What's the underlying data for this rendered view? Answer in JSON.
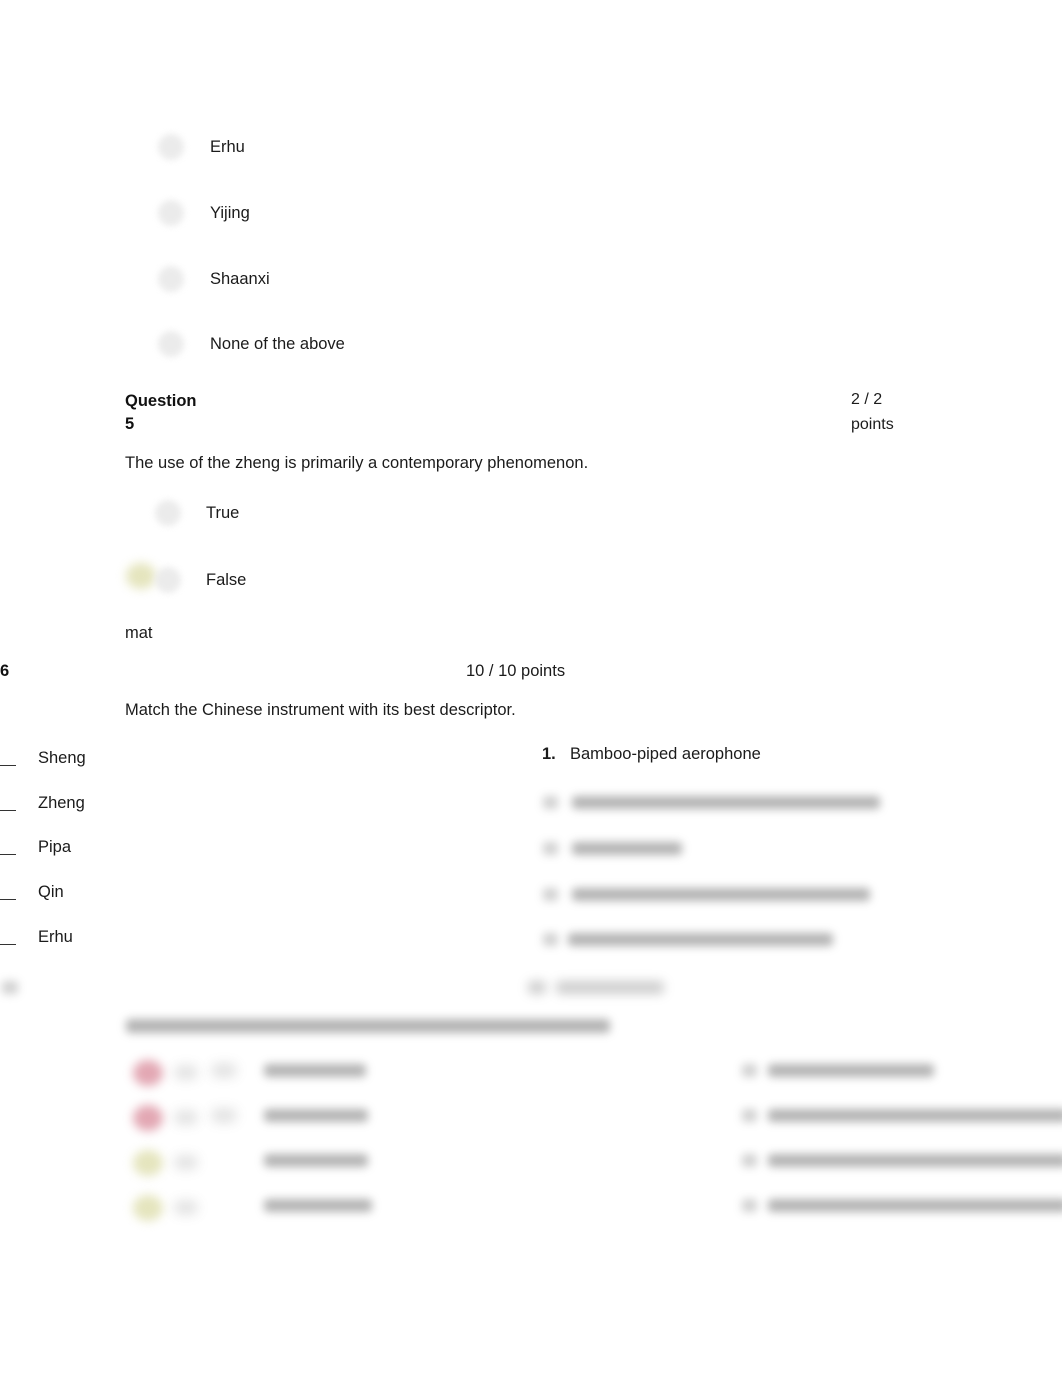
{
  "document": {
    "type": "quiz-results",
    "background_color": "#ffffff"
  },
  "question_4_options": {
    "items": [
      {
        "label": "Erhu"
      },
      {
        "label": "Yijing"
      },
      {
        "label": "Shaanxi"
      },
      {
        "label": "None of the above"
      }
    ]
  },
  "question_5": {
    "header_line_1": "Question",
    "header_line_2": "5",
    "points_line_1": "2 / 2",
    "points_line_2": "points",
    "prompt": "The use of the zheng is primarily a contemporary phenomenon.",
    "options": [
      {
        "label": "True",
        "marked": false
      },
      {
        "label": "False",
        "marked": true
      }
    ]
  },
  "fragment": {
    "text": "mat"
  },
  "question_6": {
    "number": "6",
    "points": "10 / 10 points",
    "prompt": "Match the Chinese instrument with its best descriptor.",
    "left_items": [
      {
        "blank": "_",
        "label": "Sheng"
      },
      {
        "blank": "_",
        "label": "Zheng"
      },
      {
        "blank": "_",
        "label": "Pipa"
      },
      {
        "blank": "_",
        "label": "Qin"
      },
      {
        "blank": "_",
        "label": "Erhu"
      }
    ],
    "right_items": [
      {
        "number": "1.",
        "label": "Bamboo-piped aerophone",
        "legible": true
      },
      {
        "number": "",
        "label": "",
        "legible": false
      },
      {
        "number": "",
        "label": "",
        "legible": false
      },
      {
        "number": "",
        "label": "",
        "legible": false
      },
      {
        "number": "",
        "label": "",
        "legible": false
      }
    ]
  },
  "question_7_blurred": {
    "legible": false,
    "row_markers": [
      {
        "color": "#d98a9a",
        "state": "incorrect"
      },
      {
        "color": "#d98a9a",
        "state": "incorrect"
      },
      {
        "color": "#dcdca8",
        "state": "correct"
      },
      {
        "color": "#dcdca8",
        "state": "correct"
      }
    ]
  },
  "colors": {
    "text": "#1b1b1b",
    "marker_correct": "#dcdca8",
    "marker_incorrect": "#d98a9a",
    "radio_blur": "#e8e8e8"
  }
}
